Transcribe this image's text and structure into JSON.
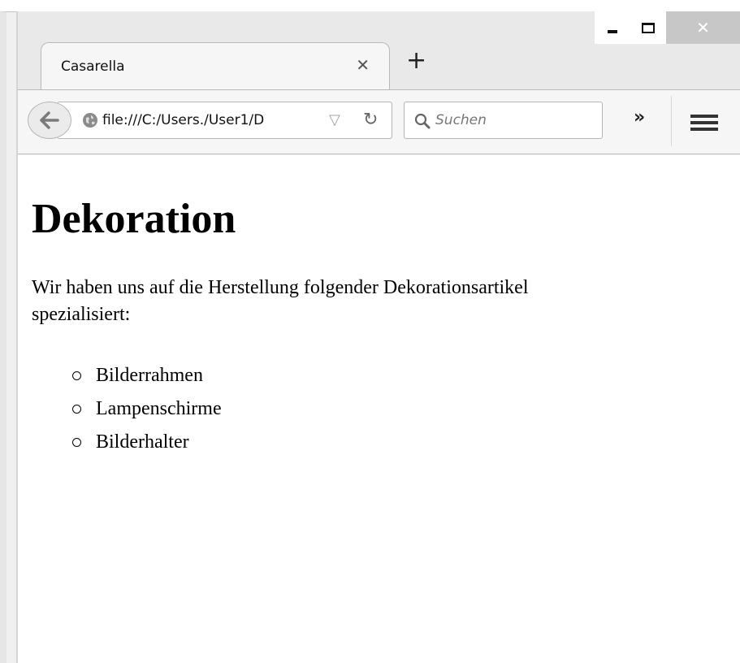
{
  "tab": {
    "title": "Casarella"
  },
  "nav": {
    "url": "file:///C:/Users./User1/D",
    "search_placeholder": "Suchen"
  },
  "page": {
    "heading": "Dekoration",
    "paragraph": "Wir haben uns auf die Herstellung folgender Dekorationsartikel spezialisiert:",
    "items": [
      "Bilderrahmen",
      "Lampenschirme",
      "Bilderhalter"
    ]
  }
}
